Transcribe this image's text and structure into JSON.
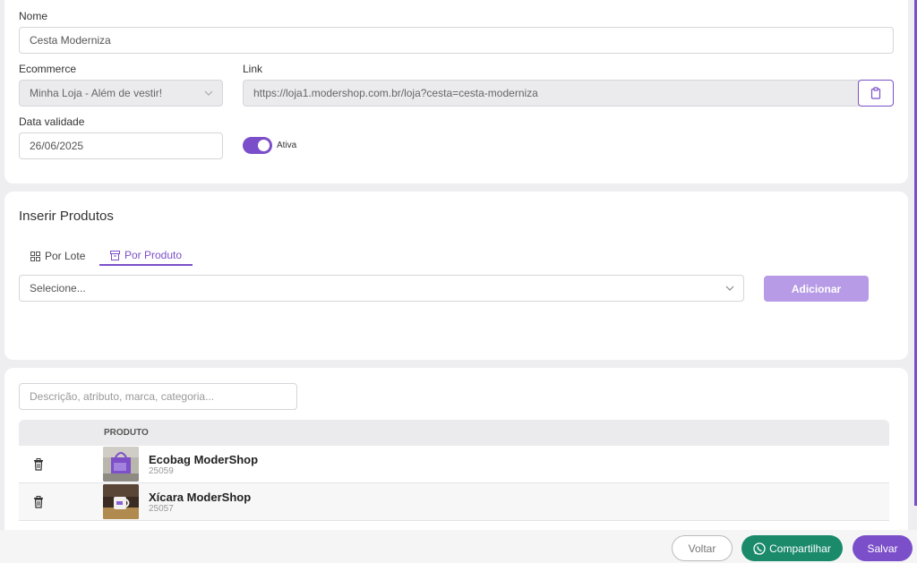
{
  "form": {
    "nome_label": "Nome",
    "nome_value": "Cesta Moderniza",
    "ecommerce_label": "Ecommerce",
    "ecommerce_value": "Minha Loja - Além de vestir!",
    "link_label": "Link",
    "link_value": "https://loja1.modershop.com.br/loja?cesta=cesta-moderniza",
    "data_label": "Data validade",
    "data_value": "26/06/2025",
    "toggle_label": "Ativa",
    "toggle_on": true
  },
  "insert": {
    "title": "Inserir Produtos",
    "tabs": [
      {
        "label": "Por Lote",
        "active": false
      },
      {
        "label": "Por Produto",
        "active": true
      }
    ],
    "select_placeholder": "Selecione...",
    "add_label": "Adicionar"
  },
  "products": {
    "search_placeholder": "Descrição, atributo, marca, categoria...",
    "column_header": "PRODUTO",
    "rows": [
      {
        "name": "Ecobag ModerShop",
        "code": "25059"
      },
      {
        "name": "Xícara ModerShop",
        "code": "25057"
      }
    ]
  },
  "footer": {
    "back_label": "Voltar",
    "share_label": "Compartilhar",
    "save_label": "Salvar"
  },
  "colors": {
    "accent": "#7b4fc9",
    "accent_light": "#b79be6",
    "whatsapp": "#1b8a6b"
  },
  "icons": [
    "clipboard-icon",
    "chevron-down-icon",
    "grid-icon",
    "archive-icon",
    "trash-icon",
    "whatsapp-icon"
  ]
}
